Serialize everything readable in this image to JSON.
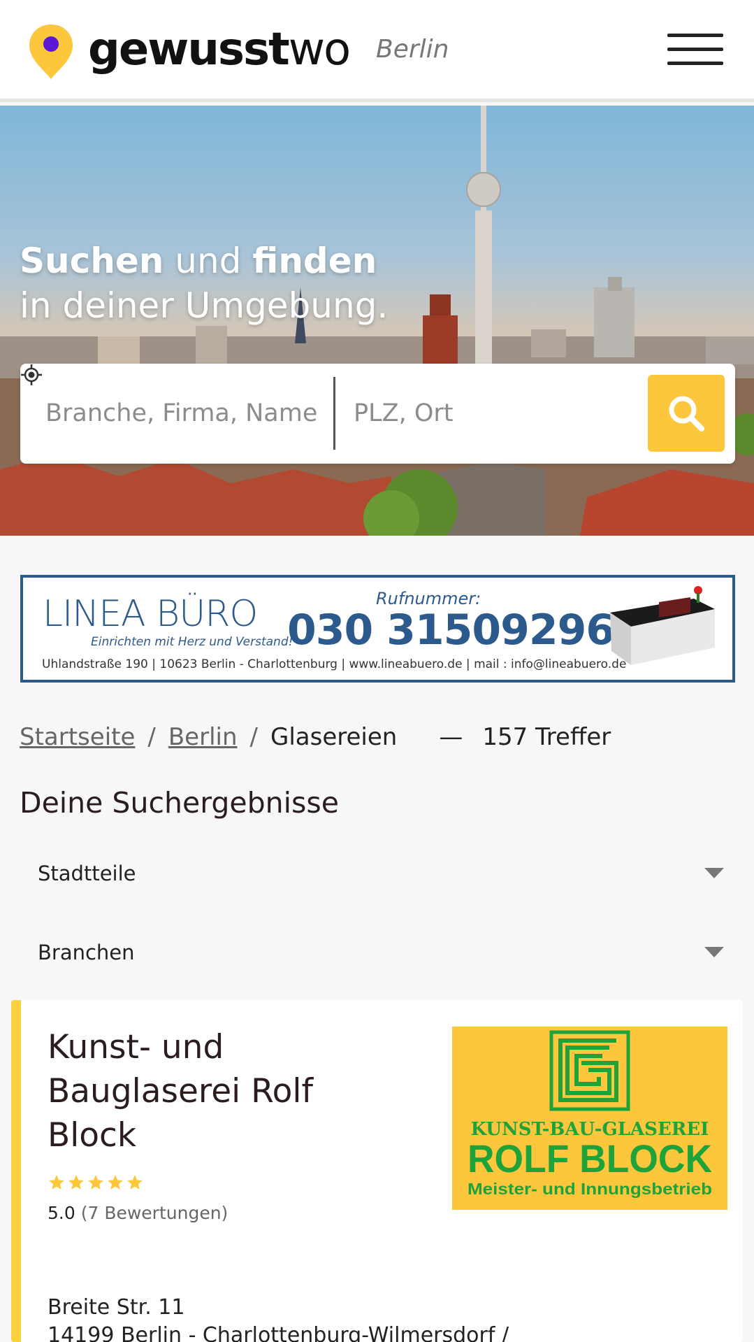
{
  "header": {
    "logo_bold": "gewusst",
    "logo_light": "wo",
    "city": "Berlin",
    "menu_icon": "hamburger-menu-icon"
  },
  "hero": {
    "title_line1_bold1": "Suchen",
    "title_line1_mid": " und ",
    "title_line1_bold2": "finden",
    "title_line2": "in deiner Umgebung.",
    "search": {
      "what_placeholder": "Branche, Firma, Name",
      "where_placeholder": "PLZ, Ort",
      "locate_icon": "crosshair-location-icon",
      "button_icon": "search-icon"
    }
  },
  "ad": {
    "brand": "LINEA BÜRO",
    "tagline": "Einrichten mit Herz und Verstand!",
    "phone_label": "Rufnummer:",
    "phone": "030 31509296",
    "address": "Uhlandstraße 190 | 10623 Berlin - Charlottenburg | www.lineabuero.de | mail : info@lineabuero.de",
    "colors": {
      "brand": "#2d5a8c"
    }
  },
  "breadcrumb": {
    "items": [
      "Startseite",
      "Berlin"
    ],
    "separator": "/",
    "current": "Glasereien",
    "dash": "—",
    "count": "157 Treffer"
  },
  "results": {
    "title": "Deine Suchergebnisse",
    "filters": [
      "Stadtteile",
      "Branchen"
    ]
  },
  "listing": {
    "name": "Kunst- und Bauglaserei Rolf Block",
    "rating_value": "5.0",
    "rating_count": "(7 Bewertungen)",
    "stars": 5,
    "logo": {
      "line1": "KUNST-BAU-GLASEREI",
      "line2": "ROLF BLOCK",
      "line3": "Meister- und Innungsbetrieb"
    },
    "address_line1": "Breite Str. 11",
    "address_line2": "14199 Berlin - Charlottenburg-Wilmersdorf /"
  },
  "colors": {
    "accent": "#fcc63d",
    "logo_pin": "#fcc63d",
    "logo_dot": "#5a18d6",
    "green": "#1ea33a"
  }
}
